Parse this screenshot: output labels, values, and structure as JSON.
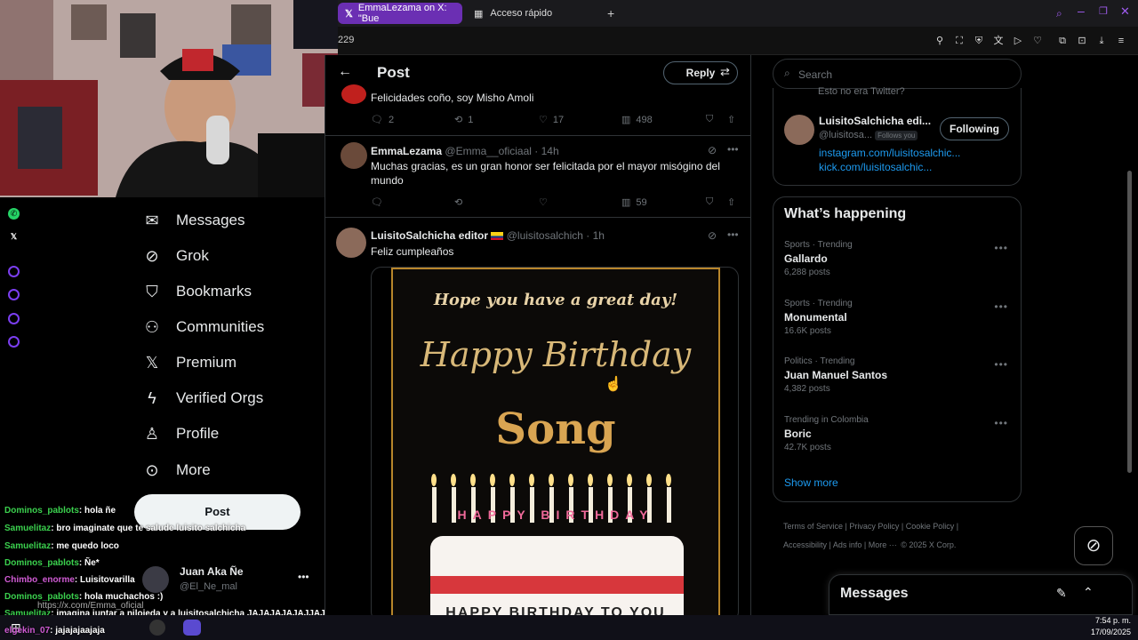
{
  "browser": {
    "tab_active": "EmmaLezama on X: \"Bue",
    "tab_other": "Acceso rápido",
    "address_partial": "229"
  },
  "nav": {
    "items": [
      {
        "label": "Messages",
        "icon": "envelope-icon"
      },
      {
        "label": "Grok",
        "icon": "grok-icon"
      },
      {
        "label": "Bookmarks",
        "icon": "bookmark-icon"
      },
      {
        "label": "Communities",
        "icon": "communities-icon"
      },
      {
        "label": "Premium",
        "icon": "x-logo-icon"
      },
      {
        "label": "Verified Orgs",
        "icon": "lightning-icon"
      },
      {
        "label": "Profile",
        "icon": "person-icon"
      },
      {
        "label": "More",
        "icon": "more-circle-icon"
      }
    ],
    "post_button": "Post",
    "account_name": "Juan Aka Ñe",
    "account_handle": "@El_Ne_mal"
  },
  "chat": [
    {
      "user": "Dominos_pablots",
      "msg": ": hola ñe",
      "color": "u1"
    },
    {
      "user": "Samuelitaz",
      "msg": ": bro imaginate que te salude luisito salchicha",
      "color": "u1"
    },
    {
      "user": "Samuelitaz",
      "msg": ": me quedo loco",
      "color": "u1"
    },
    {
      "user": "Dominos_pablots",
      "msg": ": Ñe*",
      "color": "u1"
    },
    {
      "user": "Chimbo_enorme",
      "msg": ": Luisitovarilla",
      "color": "u2"
    },
    {
      "user": "Dominos_pablots",
      "msg": ": hola muchachos :)",
      "color": "u1"
    },
    {
      "user": "Samuelitaz",
      "msg": ": imagina juntar a nilojeda y a luisitosalchicha JAJAJAJAJAJJAJA",
      "color": "u1"
    },
    {
      "user": "elgekin_07",
      "msg": ": jajajajaajaja",
      "color": "u2"
    }
  ],
  "chat_url": "https://x.com/Emma_oficial",
  "timeline": {
    "header_title": "Post",
    "reply_button": "Reply",
    "tweet1": {
      "text": "Felicidades coño, soy Misho Amoli",
      "replies": "2",
      "retweets": "1",
      "likes": "17",
      "views": "498"
    },
    "tweet2": {
      "name": "EmmaLezama",
      "handle": "@Emma__oficiaal",
      "time": "· 14h",
      "text": "Muchas gracias, es un gran honor ser felicitada por el mayor misógino del mundo",
      "views": "59"
    },
    "tweet3": {
      "name": "LuisitoSalchicha editor",
      "handle": "@luisitosalchich",
      "time": "· 1h",
      "text": "Feliz cumpleaños",
      "image_line1": "Hope you have a great day!",
      "image_line2": "Happy Birthday",
      "image_line3": "Song",
      "image_candles": "HAPPY BIRTHDAY",
      "image_bottom": "HAPPY BIRTHDAY TO YOU"
    }
  },
  "right": {
    "search_placeholder": "Search",
    "profile_top_partial": "Esto no era Twitter?",
    "profile_name": "LuisitoSalchicha edi...",
    "profile_handle": "@luisitosa...",
    "follows_you": "Follows you",
    "following_button": "Following",
    "link1": "instagram.com/luisitosalchic...",
    "link2": "kick.com/luisitosalchic...",
    "whats_happening": "What’s happening",
    "trends": [
      {
        "category": "Sports · Trending",
        "name": "Gallardo",
        "count": "6,288 posts"
      },
      {
        "category": "Sports · Trending",
        "name": "Monumental",
        "count": "16.6K posts"
      },
      {
        "category": "Politics · Trending",
        "name": "Juan Manuel Santos",
        "count": "4,382 posts"
      },
      {
        "category": "Trending in Colombia",
        "name": "Boric",
        "count": "42.7K posts"
      }
    ],
    "show_more": "Show more",
    "footer": [
      "Terms of Service",
      "Privacy Policy",
      "Cookie Policy",
      "Accessibility",
      "Ads info",
      "More ···",
      "© 2025 X Corp."
    ],
    "messages_title": "Messages"
  },
  "taskbar": {
    "time": "7:54 p. m.",
    "date": "17/09/2025"
  },
  "colors": {
    "accent_purple": "#6b2fb3",
    "x_blue": "#1d9bf0",
    "chat_green": "#3bd14e"
  }
}
